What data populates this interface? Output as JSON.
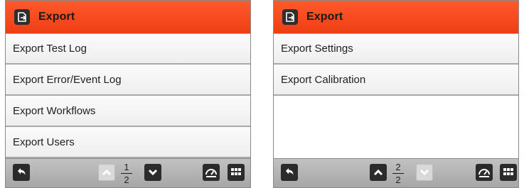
{
  "panels": [
    {
      "header": {
        "title": "Export"
      },
      "items": [
        {
          "label": "Export Test Log"
        },
        {
          "label": "Export Error/Event Log"
        },
        {
          "label": "Export Workflows"
        },
        {
          "label": "Export Users"
        }
      ],
      "pager": {
        "current": "1",
        "total": "2"
      },
      "nav": {
        "up_enabled": false,
        "down_enabled": true
      }
    },
    {
      "header": {
        "title": "Export"
      },
      "items": [
        {
          "label": "Export Settings"
        },
        {
          "label": "Export Calibration"
        }
      ],
      "pager": {
        "current": "2",
        "total": "2"
      },
      "nav": {
        "up_enabled": true,
        "down_enabled": false
      }
    }
  ],
  "icons": {
    "header": "export-icon",
    "back": "back-arrow-icon",
    "up": "chevron-up-icon",
    "down": "chevron-down-icon",
    "dashboard": "dashboard-gauge-icon",
    "menu": "grid-menu-icon"
  },
  "colors": {
    "header_accent": "#f5461d",
    "footer": "#b5b5b5",
    "button_dark": "#2b2b2b",
    "button_disabled": "#d9d9d9"
  }
}
